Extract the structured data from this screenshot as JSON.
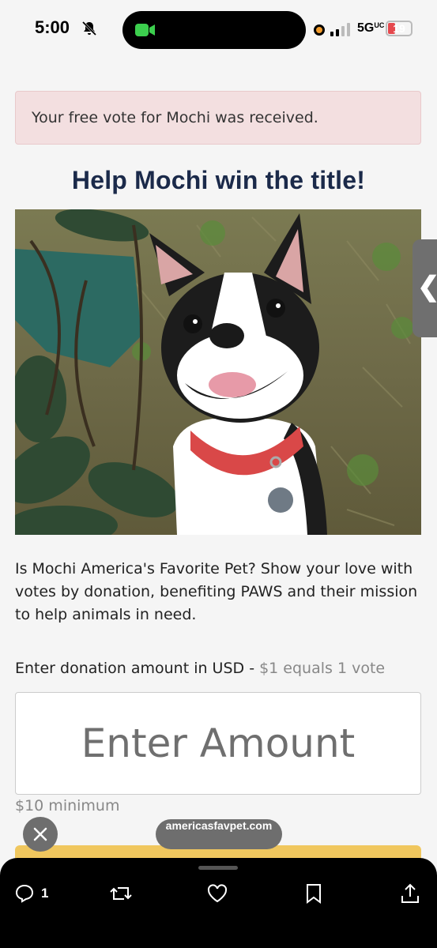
{
  "status_bar": {
    "time": "5:00",
    "network": "5G",
    "network_suffix": "UC",
    "battery": "19"
  },
  "alert": {
    "text": "Your free vote for Mochi was received."
  },
  "headline": "Help Mochi win the title!",
  "photo": {
    "subject": "boston-terrier-dog"
  },
  "description": "Is Mochi America's Favorite Pet? Show your love with votes by donation, benefiting PAWS and their mission to help animals in need.",
  "donation": {
    "label": "Enter donation amount in USD - ",
    "hint": "$1 equals 1 vote",
    "placeholder": "Enter Amount",
    "minimum": "$10 minimum"
  },
  "browser": {
    "url": "americasfavpet.com"
  },
  "actions": {
    "reply_count": "1"
  },
  "colors": {
    "alert_bg": "#f3dfe0",
    "title": "#1b2a4a",
    "button_yellow": "#f0c75e"
  }
}
